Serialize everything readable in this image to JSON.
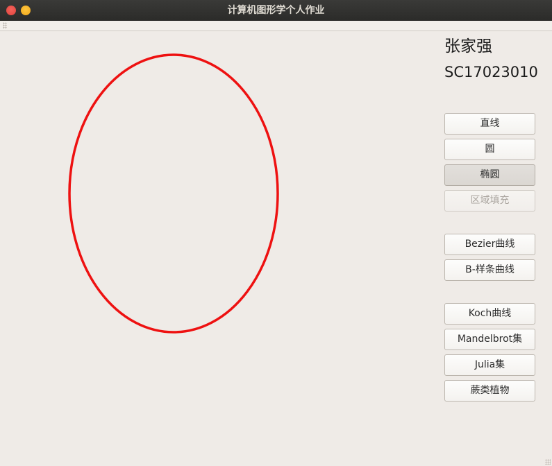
{
  "window": {
    "title": "计算机图形学个人作业"
  },
  "student": {
    "name": "张家强",
    "id": "SC17023010"
  },
  "buttons": {
    "line": "直线",
    "circle": "圆",
    "ellipse": "椭圆",
    "fill": "区域填充",
    "bezier": "Bezier曲线",
    "bspline": "B-样条曲线",
    "koch": "Koch曲线",
    "mandelbrot": "Mandelbrot集",
    "julia": "Julia集",
    "fern": "蕨类植物"
  },
  "state": {
    "active_tool": "ellipse",
    "disabled_tools": [
      "fill"
    ]
  },
  "drawing": {
    "shape": "ellipse",
    "stroke_color": "#ee1111"
  },
  "colors": {
    "window_bg": "#efebe7",
    "titlebar_bg": "#2e2e2c",
    "title_text": "#dfdbd2",
    "close_button": "#e8453e",
    "minimize_button": "#f6b42b"
  }
}
